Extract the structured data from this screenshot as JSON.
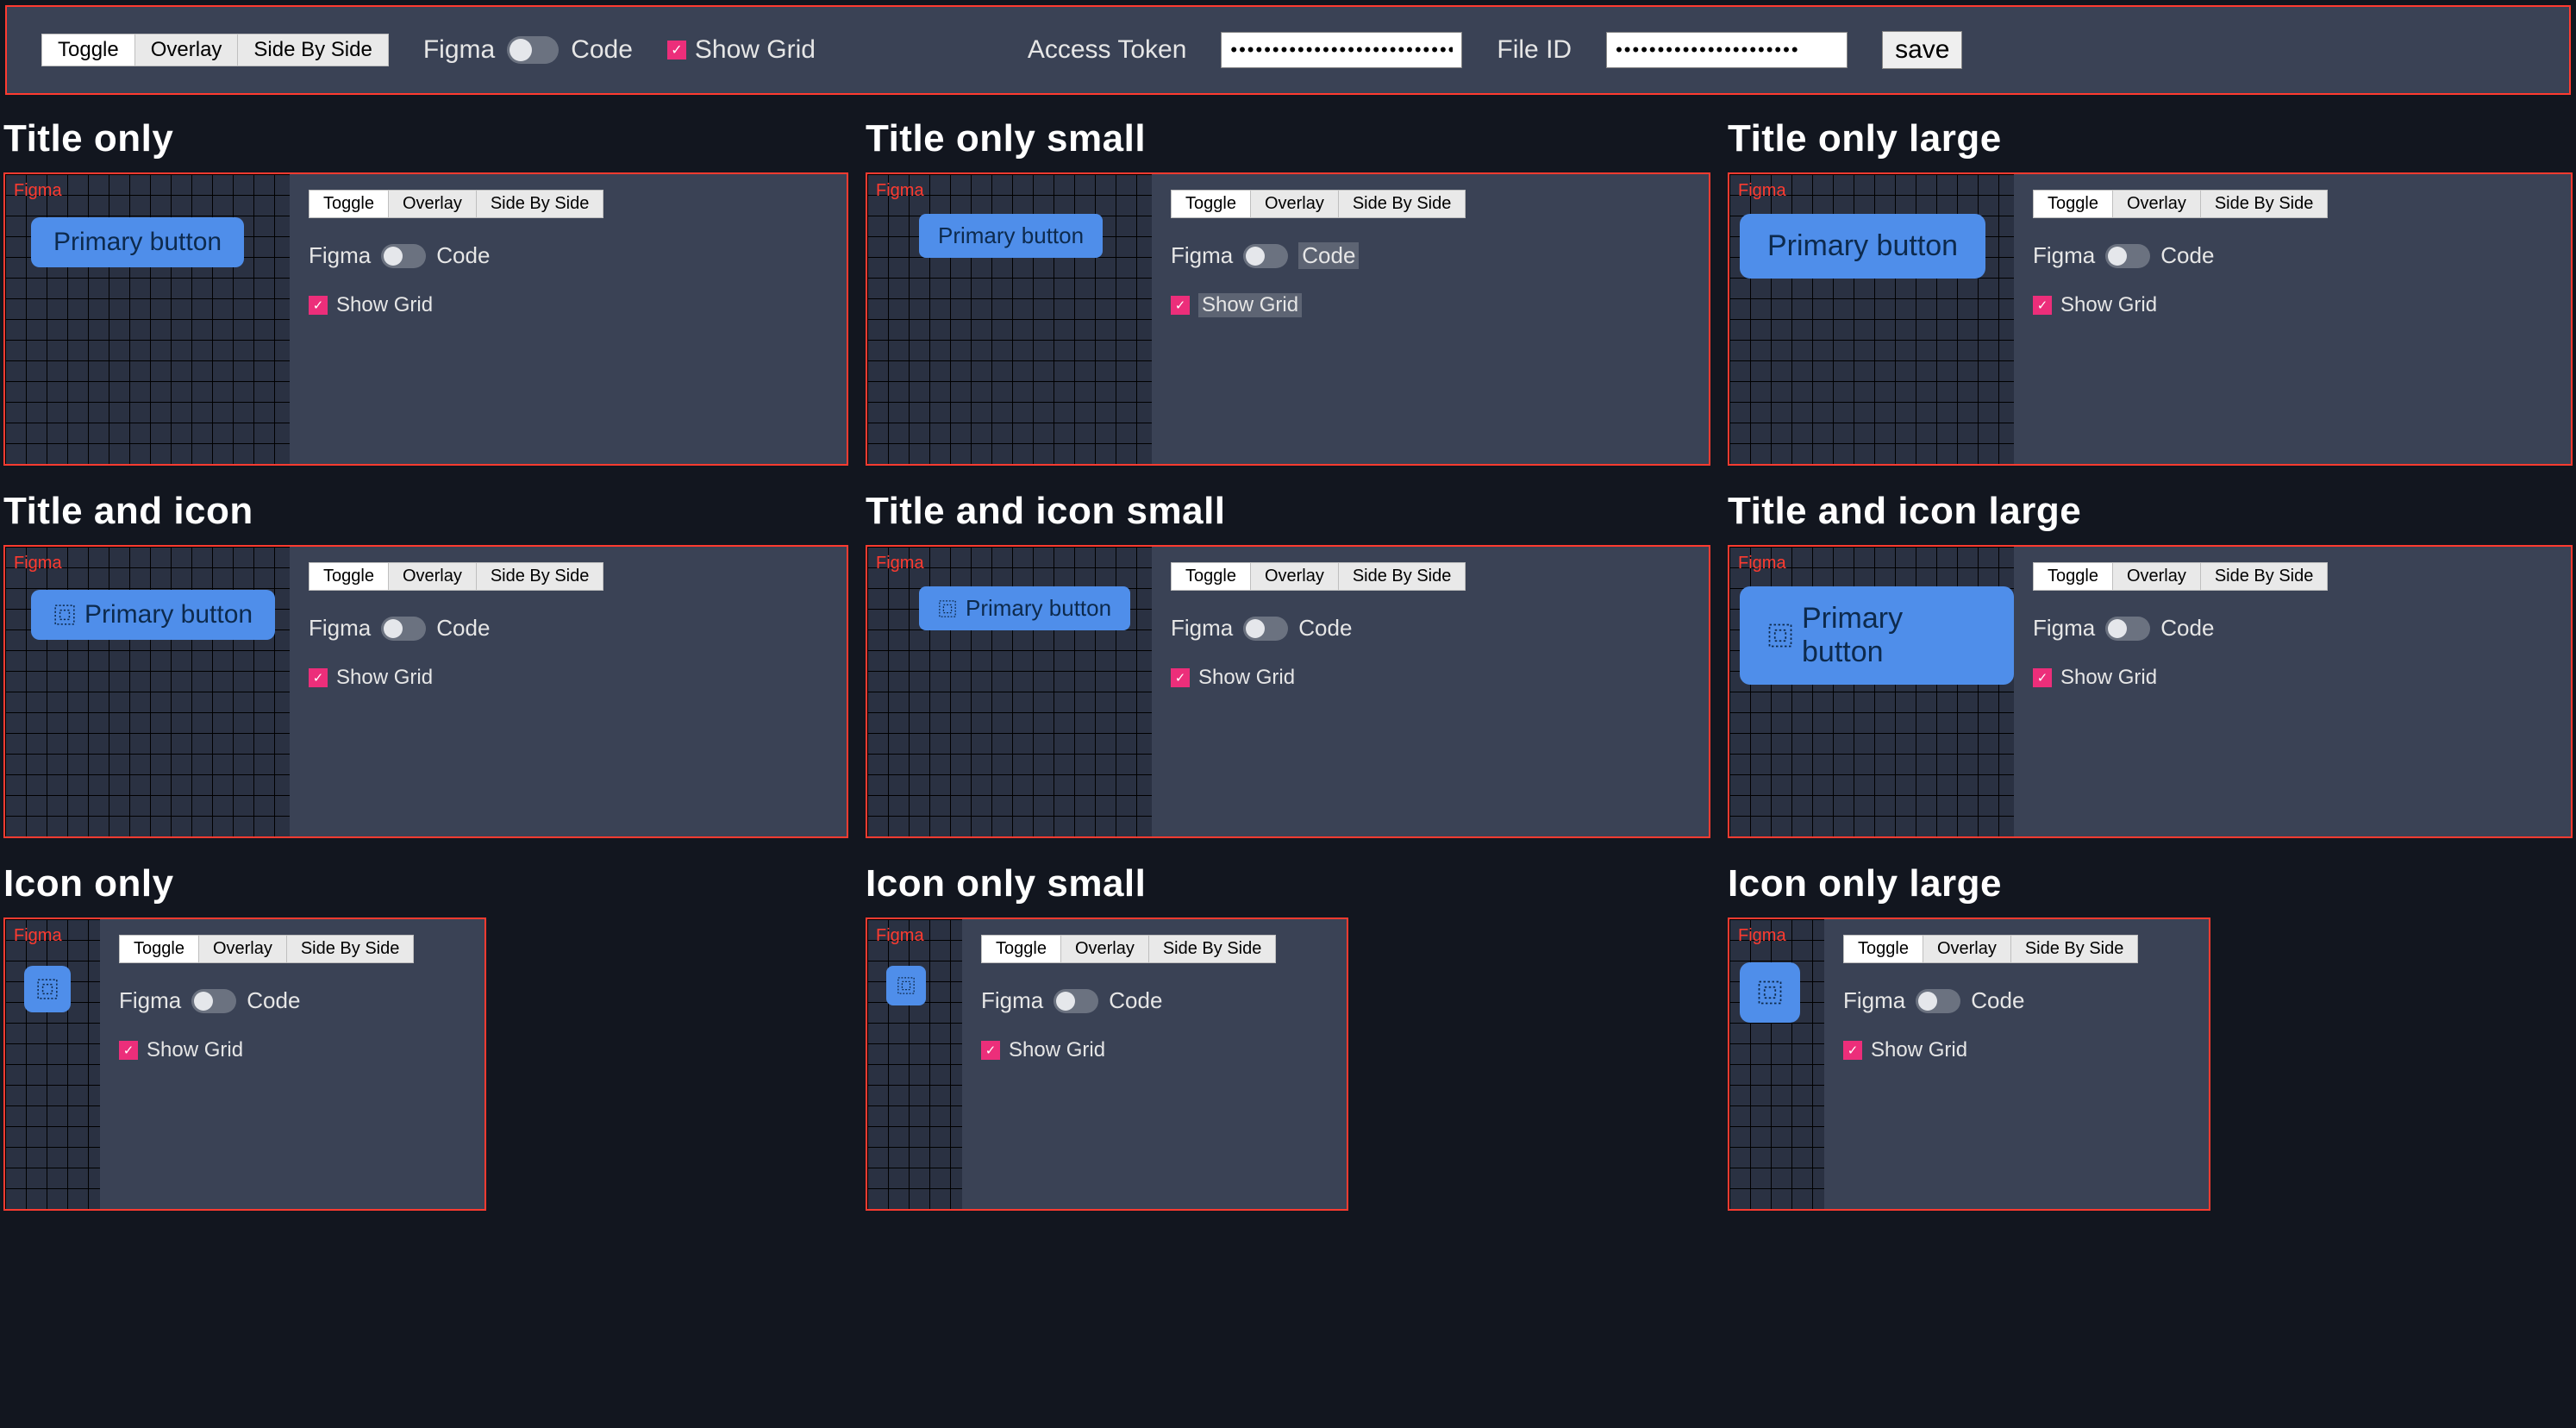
{
  "toolbar": {
    "tabs": [
      "Toggle",
      "Overlay",
      "Side By Side"
    ],
    "active_tab_index": 0,
    "figma_label": "Figma",
    "code_label": "Code",
    "showgrid_label": "Show Grid",
    "access_token_label": "Access Token",
    "file_id_label": "File ID",
    "access_token_value": "••••••••••••••••••••••••••••••••",
    "file_id_value": "••••••••••••••••••••••",
    "save_label": "save"
  },
  "story_panel": {
    "tabs": [
      "Toggle",
      "Overlay",
      "Side By Side"
    ],
    "figma_label": "Figma",
    "code_label": "Code",
    "showgrid_label": "Show Grid",
    "canvas_tag": "Figma"
  },
  "button_label": "Primary button",
  "stories": [
    {
      "title": "Title only",
      "has_icon": false,
      "has_text": true,
      "size": "m",
      "highlight": false
    },
    {
      "title": "Title only small",
      "has_icon": false,
      "has_text": true,
      "size": "s",
      "highlight": true
    },
    {
      "title": "Title only large",
      "has_icon": false,
      "has_text": true,
      "size": "l",
      "highlight": false
    },
    {
      "title": "Title and icon",
      "has_icon": true,
      "has_text": true,
      "size": "m",
      "highlight": false
    },
    {
      "title": "Title and icon small",
      "has_icon": true,
      "has_text": true,
      "size": "s",
      "highlight": false
    },
    {
      "title": "Title and icon large",
      "has_icon": true,
      "has_text": true,
      "size": "l",
      "highlight": false
    },
    {
      "title": "Icon only",
      "has_icon": true,
      "has_text": false,
      "size": "m",
      "highlight": false
    },
    {
      "title": "Icon only small",
      "has_icon": true,
      "has_text": false,
      "size": "s",
      "highlight": false
    },
    {
      "title": "Icon only large",
      "has_icon": true,
      "has_text": false,
      "size": "l",
      "highlight": false
    }
  ]
}
